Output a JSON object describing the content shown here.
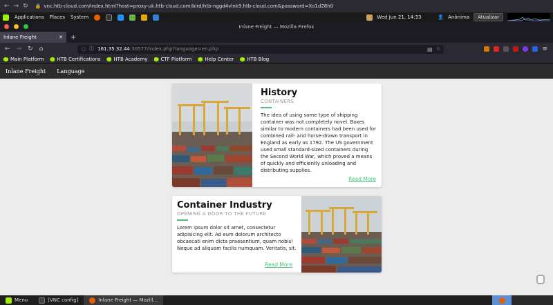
{
  "vnc_bar": {
    "url": "vnc.htb-cloud.com/index.html?host=proxy-uk.htb-cloud.com/bird/htb-nggd4vlnk9.htb-cloud.com&password=Xo1d28h0"
  },
  "desktop_panel": {
    "menu_items": [
      "Applications",
      "Places",
      "System"
    ],
    "datetime": "Wed Jun 21, 14:33",
    "user": "Anônima",
    "update_button": "Atualizar"
  },
  "firefox": {
    "window_title": "Inlane Freight — Mozilla Firefox",
    "tab_title": "Inlane Freight",
    "url_host": "161.35.32.44",
    "url_path": ":30577/index.php?language=en.php",
    "bookmarks": [
      "Main Platform",
      "HTB Certifications",
      "HTB Academy",
      "CTF Platform",
      "Help Center",
      "HTB Blog"
    ]
  },
  "site": {
    "nav": [
      "Inlane Freight",
      "Language"
    ],
    "cards": [
      {
        "title": "History",
        "subtitle": "CONTAINERS",
        "text": "The idea of using some type of shipping container was not completely novel. Boxes similar to modern containers had been used for combined rail- and horse-drawn transport in England as early as 1792. The US government used small standard-sized containers during the Second World War, which proved a means of quickly and efficiently unloading and distributing supplies.",
        "link": "Read More"
      },
      {
        "title": "Container Industry",
        "subtitle": "OPENING A DOOR TO THE FUTURE",
        "text": "Lorem ipsum dolor sit amet, consectetur adipisicing elit. Ad eum dolorum architecto obcaecati enim dicta praesentium, quam nobis! Neque ad aliquam facilis numquam. Veritatis, sit.",
        "link": "Read More"
      }
    ],
    "accent_color": "#4ac07d"
  },
  "taskbar": {
    "items": [
      "Menu",
      "[VNC config]",
      "Inlane Freight — Mozill..."
    ]
  }
}
